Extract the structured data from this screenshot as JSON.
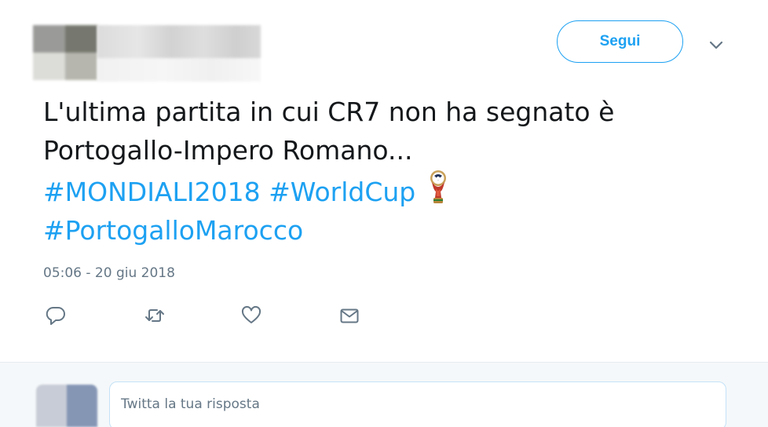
{
  "header": {
    "follow_label": "Segui",
    "caret_icon": "chevron-down-icon"
  },
  "tweet": {
    "line1": "L'ultima partita in cui CR7 non ha segnato è",
    "line2": "Portogallo-Impero Romano...",
    "hashtags_line3": [
      "#MONDIALI2018",
      "#WorldCup"
    ],
    "hashtags_line4": [
      "#PortogalloMarocco"
    ],
    "emoji_icon": "world-cup-trophy-icon",
    "timestamp": "05:06 - 20 giu 2018"
  },
  "actions": [
    {
      "name": "reply",
      "icon": "reply-icon"
    },
    {
      "name": "retweet",
      "icon": "retweet-icon"
    },
    {
      "name": "like",
      "icon": "heart-icon"
    },
    {
      "name": "message",
      "icon": "envelope-icon"
    }
  ],
  "reply": {
    "placeholder": "Twitta la tua risposta"
  },
  "colors": {
    "accent": "#1da1f2",
    "text": "#14171a",
    "muted": "#657786",
    "reply_bg": "#f5f8fa"
  }
}
